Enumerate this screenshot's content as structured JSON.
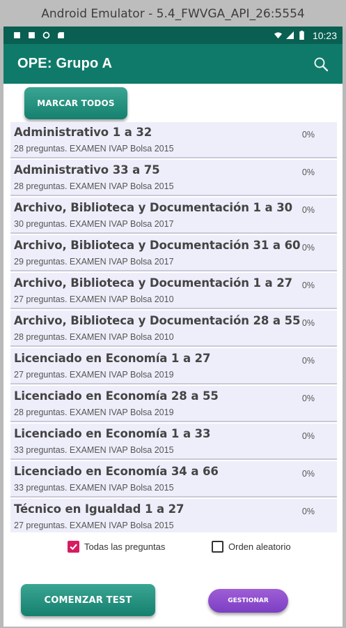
{
  "window": {
    "title": "Android Emulator - 5.4_FWVGA_API_26:5554"
  },
  "status_bar": {
    "time": "10:23",
    "colors": {
      "bar": "#095f52"
    }
  },
  "app_bar": {
    "title": "OPE: Grupo A",
    "color": "#0f7a69",
    "search_icon": "search-icon"
  },
  "buttons": {
    "mark_all": "MARCAR TODOS",
    "start_test": "COMENZAR TEST",
    "manage": "GESTIONAR"
  },
  "list": {
    "items": [
      {
        "title": "Administrativo 1 a 32",
        "subtitle": "28 preguntas.  EXAMEN  IVAP Bolsa 2015",
        "progress": "0%"
      },
      {
        "title": "Administrativo 33 a 75",
        "subtitle": "28 preguntas.  EXAMEN  IVAP Bolsa 2015",
        "progress": "0%"
      },
      {
        "title": "Archivo, Biblioteca y Documentación 1 a 30",
        "subtitle": "30 preguntas.  EXAMEN  IVAP Bolsa 2017",
        "progress": "0%"
      },
      {
        "title": "Archivo, Biblioteca y Documentación 31 a 60",
        "subtitle": "29 preguntas.  EXAMEN  IVAP Bolsa 2017",
        "progress": "0%"
      },
      {
        "title": "Archivo, Biblioteca y Documentación 1 a 27",
        "subtitle": "27 preguntas.  EXAMEN  IVAP Bolsa 2010",
        "progress": "0%"
      },
      {
        "title": "Archivo, Biblioteca y Documentación 28 a 55",
        "subtitle": "28 preguntas.  EXAMEN  IVAP Bolsa 2010",
        "progress": "0%"
      },
      {
        "title": "Licenciado en Economía 1 a 27",
        "subtitle": "27 preguntas.  EXAMEN  IVAP Bolsa 2019",
        "progress": "0%"
      },
      {
        "title": "Licenciado en Economía 28 a 55",
        "subtitle": "28 preguntas.  EXAMEN  IVAP Bolsa 2019",
        "progress": "0%"
      },
      {
        "title": "Licenciado en Economía 1 a 33",
        "subtitle": "33 preguntas.  EXAMEN  IVAP Bolsa 2015",
        "progress": "0%"
      },
      {
        "title": "Licenciado en Economía 34 a 66",
        "subtitle": "33 preguntas.  EXAMEN  IVAP Bolsa 2015",
        "progress": "0%"
      },
      {
        "title": "Técnico en Igualdad 1 a 27",
        "subtitle": "27 preguntas.  EXAMEN  IVAP Bolsa 2015",
        "progress": "0%"
      }
    ]
  },
  "options": {
    "all_questions": {
      "label": "Todas las preguntas",
      "checked": true
    },
    "random_order": {
      "label": "Orden aleatorio",
      "checked": false
    }
  }
}
